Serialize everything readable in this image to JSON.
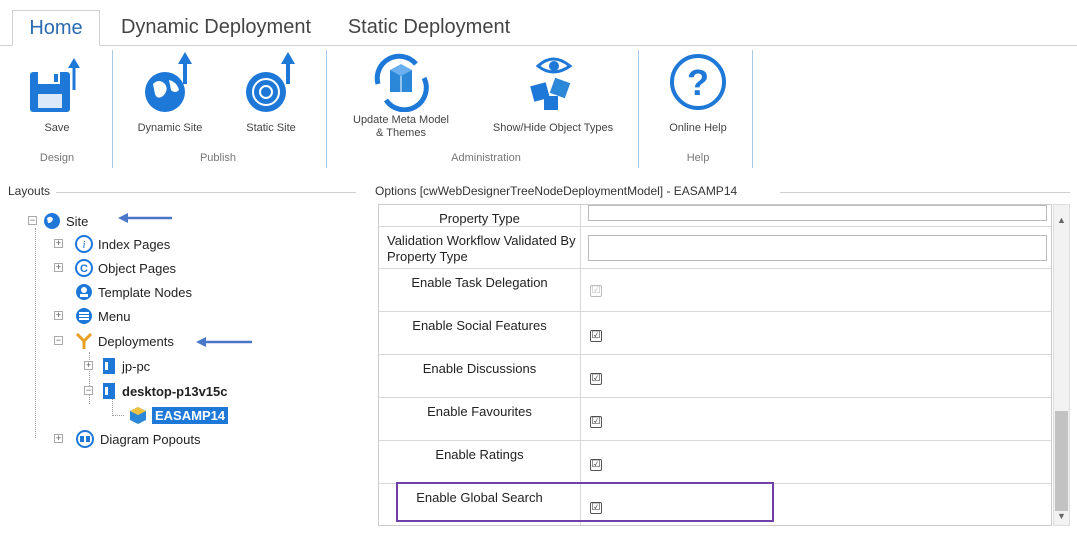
{
  "tabs": [
    "Home",
    "Dynamic Deployment",
    "Static Deployment"
  ],
  "ribbon": {
    "save_label": "Save",
    "dynamic_site_label": "Dynamic Site",
    "static_site_label": "Static Site",
    "update_meta_label_1": "Update Meta Model",
    "update_meta_label_2": "& Themes",
    "show_hide_label": "Show/Hide Object Types",
    "online_help_label": "Online Help",
    "groups": {
      "design": "Design",
      "publish": "Publish",
      "administration": "Administration",
      "help": "Help"
    }
  },
  "layouts": {
    "title": "Layouts",
    "tree": {
      "site": "Site",
      "index_pages": "Index Pages",
      "object_pages": "Object Pages",
      "template_nodes": "Template Nodes",
      "menu": "Menu",
      "deployments": "Deployments",
      "jp_pc": "jp-pc",
      "desktop": "desktop-p13v15c",
      "easamp": "EASAMP14",
      "diagram_popouts": "Diagram Popouts"
    }
  },
  "options": {
    "title": "Options [cwWebDesignerTreeNodeDeploymentModel] - EASAMP14",
    "rows": [
      {
        "name": "Property Type",
        "kind": "text"
      },
      {
        "name": "Validation Workflow Validated By Property Type",
        "kind": "text"
      },
      {
        "name": "Enable Task Delegation",
        "kind": "check",
        "checked": true,
        "disabled": true
      },
      {
        "name": "Enable Social Features",
        "kind": "check",
        "checked": true
      },
      {
        "name": "Enable Discussions",
        "kind": "check",
        "checked": true
      },
      {
        "name": "Enable Favourites",
        "kind": "check",
        "checked": true
      },
      {
        "name": "Enable Ratings",
        "kind": "check",
        "checked": true
      },
      {
        "name": "Enable Global Search",
        "kind": "check",
        "checked": true
      }
    ]
  },
  "colors": {
    "accent": "#1e78d7",
    "highlight": "#7040a8",
    "arrow": "#4a78c8"
  },
  "check_glyph": "☑"
}
